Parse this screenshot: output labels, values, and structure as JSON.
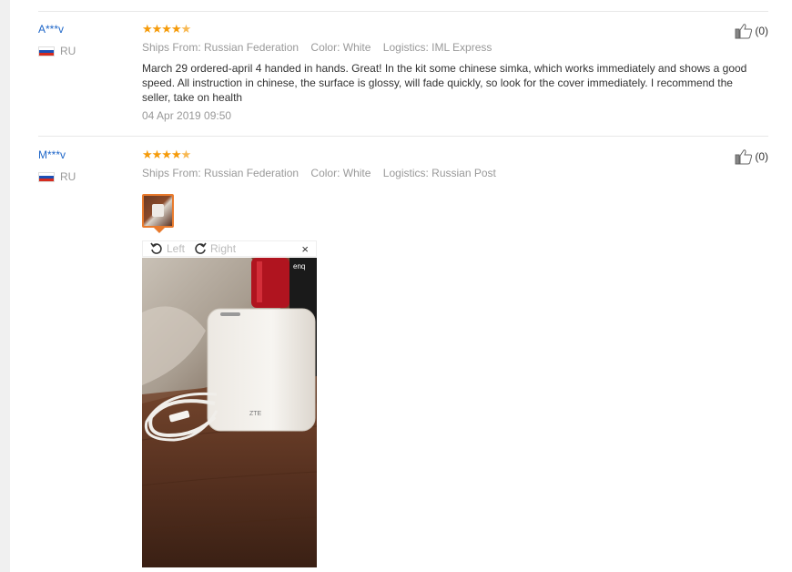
{
  "reviews": [
    {
      "user": "A***v",
      "country": "RU",
      "rating": 5,
      "ships_from": "Ships From: Russian Federation",
      "color": "Color: White",
      "logistics": "Logistics: IML Express",
      "text": "March 29 ordered-april 4 handed in hands. Great! In the kit some chinese simka, which works immediately and shows a good speed. All instruction in chinese, the surface is glossy, will fade quickly, so look for the cover immediately. I recommend the seller, take on health",
      "date": "04 Apr 2019 09:50",
      "useful_count": "(0)"
    },
    {
      "user": "M***v",
      "country": "RU",
      "rating": 5,
      "ships_from": "Ships From: Russian Federation",
      "color": "Color: White",
      "logistics": "Logistics: Russian Post",
      "useful_count": "(0)",
      "viewer": {
        "rotate_left": "Left",
        "rotate_right": "Right",
        "close": "×"
      },
      "photo_brand_mark": "ZTE"
    }
  ],
  "colors": {
    "link": "#1e66c8",
    "star": "#f59b0a",
    "accent": "#e87a2d"
  }
}
